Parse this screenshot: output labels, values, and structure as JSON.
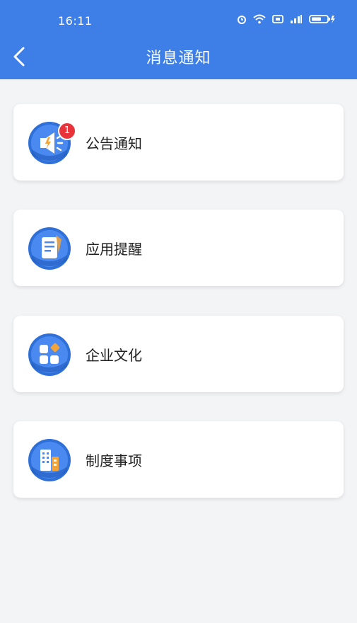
{
  "status_bar": {
    "time": "16:11"
  },
  "header": {
    "title": "消息通知"
  },
  "menu": [
    {
      "label": "公告通知",
      "icon": "megaphone-icon",
      "badge": "1"
    },
    {
      "label": "应用提醒",
      "icon": "document-icon"
    },
    {
      "label": "企业文化",
      "icon": "apps-icon"
    },
    {
      "label": "制度事项",
      "icon": "building-icon"
    }
  ],
  "colors": {
    "header": "#3d7fe6",
    "badge": "#e8333a",
    "icon_blue": "#3d7fe6",
    "accent": "#f2a43a"
  }
}
